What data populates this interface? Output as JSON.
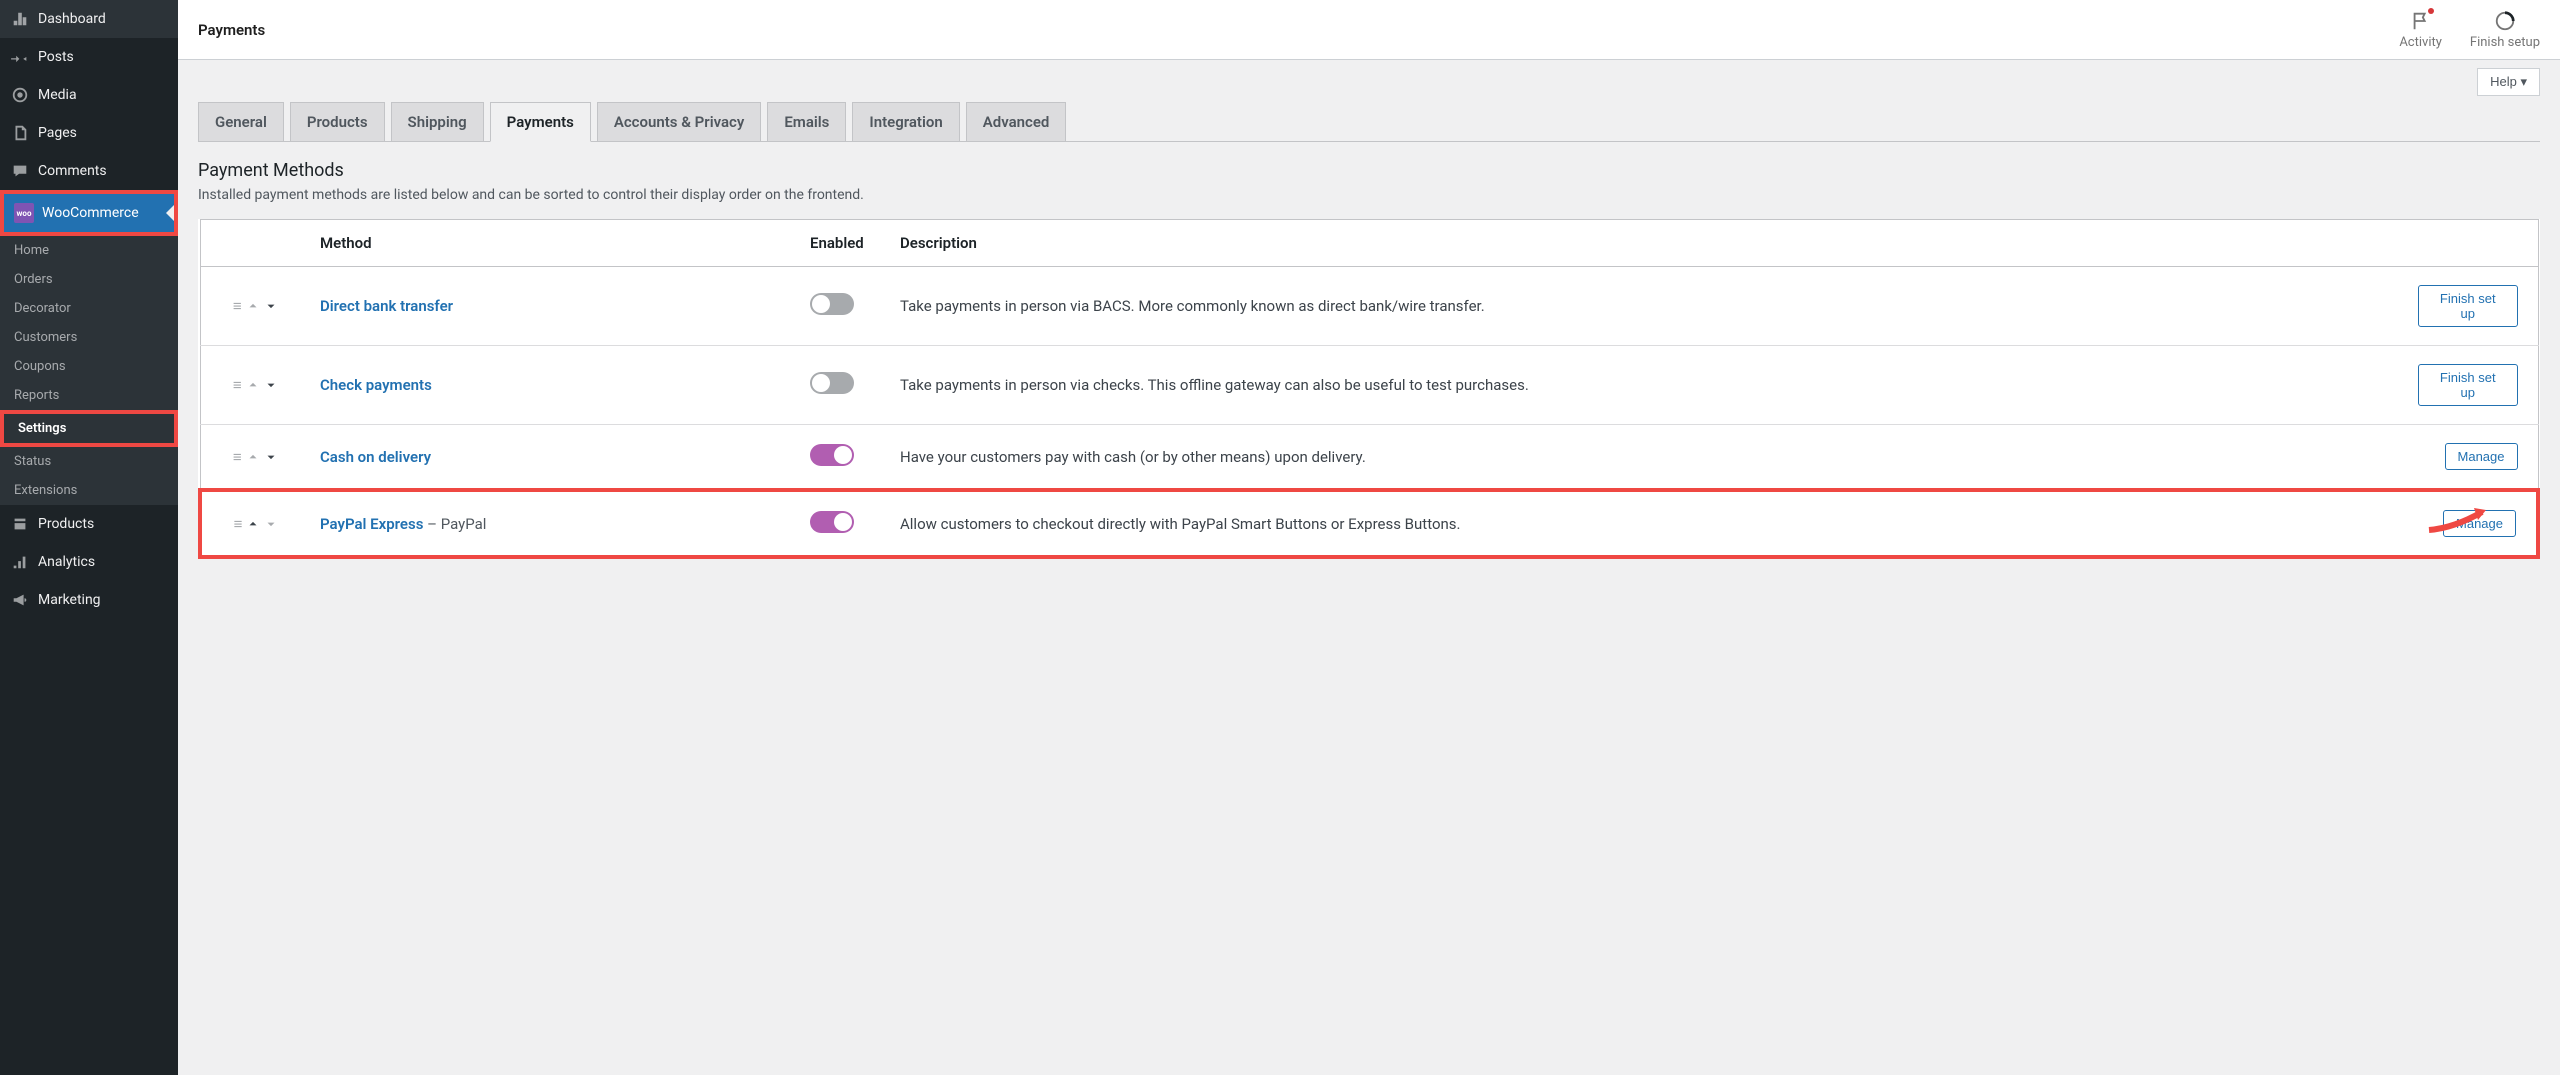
{
  "sidebar": {
    "items": [
      {
        "label": "Dashboard",
        "icon": "dashboard-icon"
      },
      {
        "label": "Posts",
        "icon": "pin-icon"
      },
      {
        "label": "Media",
        "icon": "media-icon"
      },
      {
        "label": "Pages",
        "icon": "pages-icon"
      },
      {
        "label": "Comments",
        "icon": "comment-icon"
      },
      {
        "label": "WooCommerce",
        "icon": "woo-icon",
        "active": true,
        "highlight": true
      },
      {
        "label": "Products",
        "icon": "products-icon"
      },
      {
        "label": "Analytics",
        "icon": "analytics-icon"
      },
      {
        "label": "Marketing",
        "icon": "megaphone-icon"
      }
    ],
    "woo_submenu": [
      {
        "label": "Home"
      },
      {
        "label": "Orders"
      },
      {
        "label": "Decorator"
      },
      {
        "label": "Customers"
      },
      {
        "label": "Coupons"
      },
      {
        "label": "Reports"
      },
      {
        "label": "Settings",
        "active": true,
        "highlight": true
      },
      {
        "label": "Status"
      },
      {
        "label": "Extensions"
      }
    ]
  },
  "topbar": {
    "title": "Payments",
    "activity": "Activity",
    "finish_setup": "Finish setup"
  },
  "help_label": "Help ▾",
  "tabs": [
    {
      "label": "General"
    },
    {
      "label": "Products"
    },
    {
      "label": "Shipping"
    },
    {
      "label": "Payments",
      "active": true,
      "highlight": true
    },
    {
      "label": "Accounts & Privacy"
    },
    {
      "label": "Emails"
    },
    {
      "label": "Integration"
    },
    {
      "label": "Advanced"
    }
  ],
  "section": {
    "title": "Payment Methods",
    "desc": "Installed payment methods are listed below and can be sorted to control their display order on the frontend."
  },
  "columns": {
    "method": "Method",
    "enabled": "Enabled",
    "description": "Description"
  },
  "rows": [
    {
      "method": "Direct bank transfer",
      "suffix": "",
      "enabled": false,
      "desc": "Take payments in person via BACS. More commonly known as direct bank/wire transfer.",
      "action": "Finish set up",
      "up_disabled": true,
      "down_disabled": false,
      "highlight": false
    },
    {
      "method": "Check payments",
      "suffix": "",
      "enabled": false,
      "desc": "Take payments in person via checks. This offline gateway can also be useful to test purchases.",
      "action": "Finish set up",
      "up_disabled": true,
      "down_disabled": false,
      "highlight": false
    },
    {
      "method": "Cash on delivery",
      "suffix": "",
      "enabled": true,
      "desc": "Have your customers pay with cash (or by other means) upon delivery.",
      "action": "Manage",
      "up_disabled": true,
      "down_disabled": false,
      "highlight": false
    },
    {
      "method": "PayPal Express",
      "suffix": " – PayPal",
      "enabled": true,
      "desc": "Allow customers to checkout directly with PayPal Smart Buttons or Express Buttons.",
      "action": "Manage",
      "up_disabled": false,
      "down_disabled": true,
      "highlight": true,
      "arrow": true
    }
  ]
}
